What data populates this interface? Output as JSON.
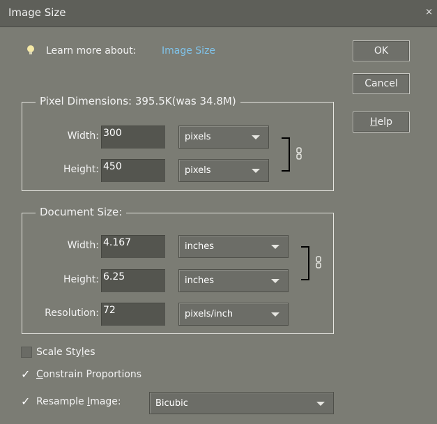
{
  "window": {
    "title": "Image Size",
    "close_glyph": "×"
  },
  "hint": {
    "text": "Learn more about:",
    "link": "Image Size"
  },
  "buttons": {
    "ok": "OK",
    "cancel": "Cancel",
    "help_prefix": "",
    "help_mnemonic": "H",
    "help_rest": "elp"
  },
  "pixel_dimensions": {
    "title": "Pixel Dimensions: 395.5K(was 34.8M)",
    "width_label": "Width:",
    "width_value": "300",
    "width_unit": "pixels",
    "height_label": "Height:",
    "height_value": "450",
    "height_unit": "pixels"
  },
  "document_size": {
    "title": "Document Size:",
    "width_label": "Width:",
    "width_value": "4.167",
    "width_unit": "inches",
    "height_label": "Height:",
    "height_value": "6.25",
    "height_unit": "inches",
    "resolution_label": "Resolution:",
    "resolution_value": "72",
    "resolution_unit": "pixels/inch"
  },
  "options": {
    "scale_styles": {
      "pre": "Scale Sty",
      "mnemonic": "l",
      "post": "es",
      "checked": false
    },
    "constrain": {
      "pre": "",
      "mnemonic": "C",
      "post": "onstrain Proportions",
      "checked": true
    },
    "resample": {
      "pre": "Resample ",
      "mnemonic": "I",
      "post": "mage:",
      "checked": true,
      "method": "Bicubic"
    }
  },
  "colors": {
    "background": "#7b7c74",
    "titlebar": "#5e5f59",
    "link": "#7fc3ea",
    "field": "#54554f"
  },
  "check_glyph": "✓"
}
